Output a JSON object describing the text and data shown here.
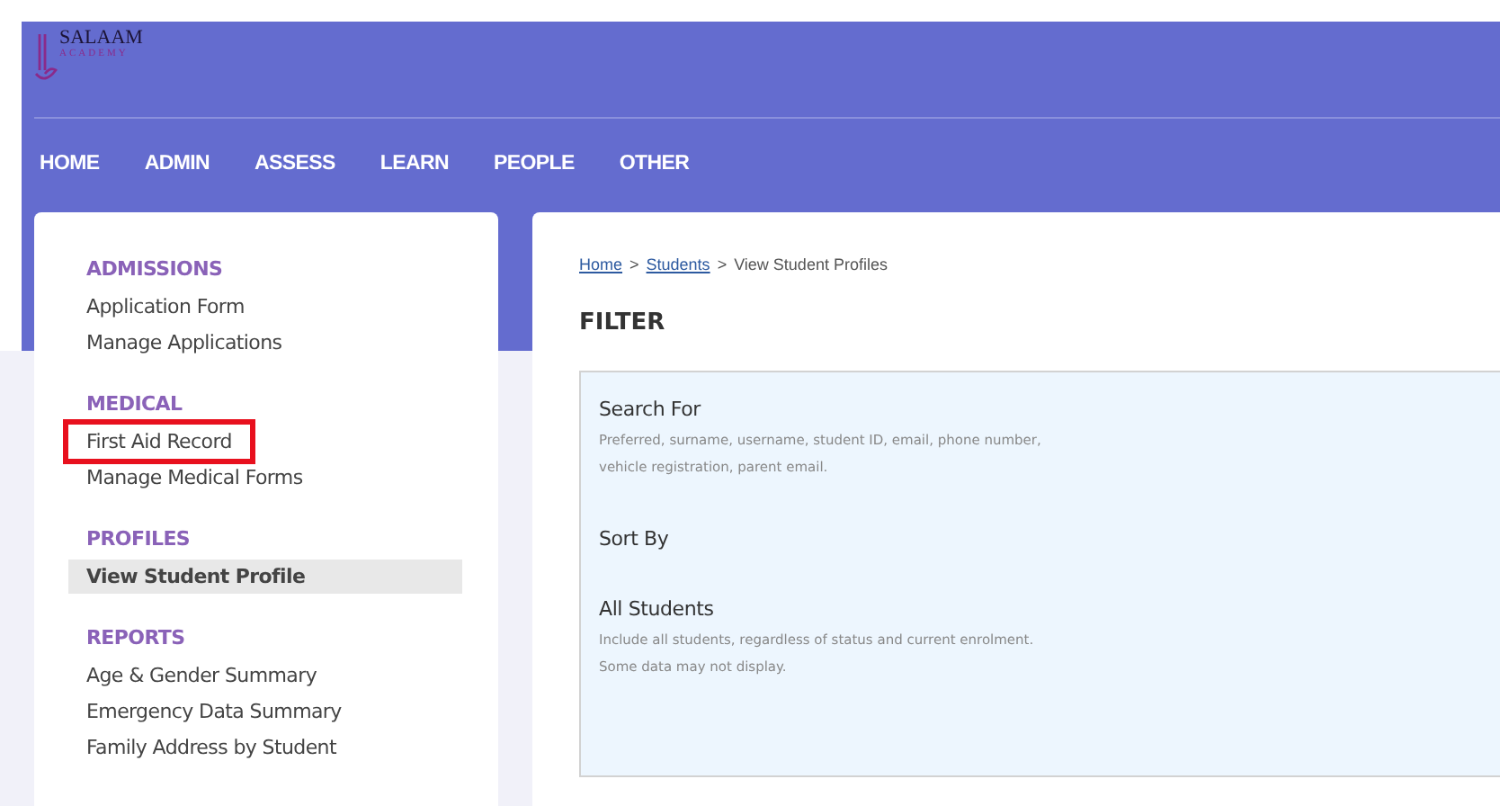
{
  "logo": {
    "name": "SALAAM",
    "tagline": "ACADEMY"
  },
  "nav": [
    {
      "label": "HOME"
    },
    {
      "label": "ADMIN"
    },
    {
      "label": "ASSESS"
    },
    {
      "label": "LEARN"
    },
    {
      "label": "PEOPLE"
    },
    {
      "label": "OTHER"
    }
  ],
  "sidebar": {
    "sections": [
      {
        "heading": "ADMISSIONS",
        "items": [
          {
            "label": "Application Form",
            "selected": false,
            "highlighted": false
          },
          {
            "label": "Manage Applications",
            "selected": false,
            "highlighted": false
          }
        ]
      },
      {
        "heading": "MEDICAL",
        "items": [
          {
            "label": "First Aid Record",
            "selected": false,
            "highlighted": true
          },
          {
            "label": "Manage Medical Forms",
            "selected": false,
            "highlighted": false
          }
        ]
      },
      {
        "heading": "PROFILES",
        "items": [
          {
            "label": "View Student Profile",
            "selected": true,
            "highlighted": false
          }
        ]
      },
      {
        "heading": "REPORTS",
        "items": [
          {
            "label": "Age & Gender Summary",
            "selected": false,
            "highlighted": false
          },
          {
            "label": "Emergency Data Summary",
            "selected": false,
            "highlighted": false
          },
          {
            "label": "Family Address by Student",
            "selected": false,
            "highlighted": false
          }
        ]
      }
    ]
  },
  "breadcrumb": {
    "links": [
      "Home",
      "Students"
    ],
    "separator": ">",
    "current": "View Student Profiles"
  },
  "filter": {
    "title": "FILTER",
    "fields": [
      {
        "label": "Search For",
        "description": [
          "Preferred, surname, username, student ID, email, phone number,",
          "vehicle registration, parent email."
        ]
      },
      {
        "label": "Sort By"
      },
      {
        "label": "All Students",
        "description": [
          "Include all students, regardless of status and current enrolment.",
          "Some data may not display."
        ]
      }
    ]
  }
}
